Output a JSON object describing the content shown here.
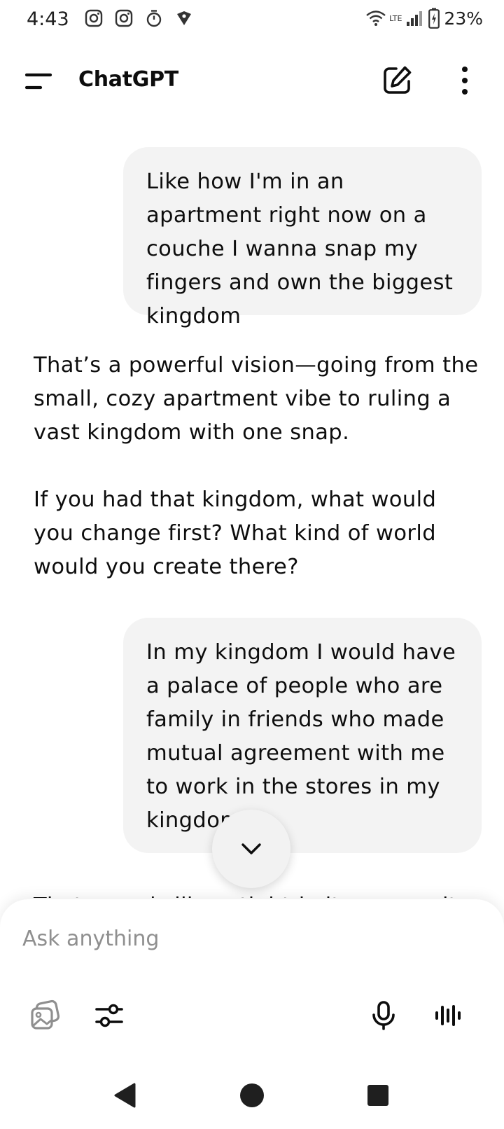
{
  "status_bar": {
    "time": "4:43",
    "network": "LTE",
    "battery": "23%",
    "notification_icons": [
      "instagram-icon",
      "instagram-icon",
      "timer-icon",
      "shield-icon"
    ]
  },
  "header": {
    "title": "ChatGPT"
  },
  "conversation": {
    "user_message_1": "Like how I'm in an apartment right now on a couche I wanna snap my fingers and own the biggest kingdom",
    "assistant_para_1": "That’s a powerful vision—going from the small, cozy apartment vibe to ruling a vast kingdom with one snap.",
    "assistant_para_2": "If you had that kingdom, what would you change first? What kind of world would you create there?",
    "user_message_2": "In my kingdom I would have a palace of people who are family in friends who made mutual agreement with me to work in the stores in my kingdom.",
    "assistant_para_3_partial": "That sounds like a tight-knit community"
  },
  "composer": {
    "placeholder": "Ask anything"
  },
  "colors": {
    "bubble": "#f3f3f3",
    "text": "#0d0d0d",
    "placeholder": "#8f8f8f"
  }
}
